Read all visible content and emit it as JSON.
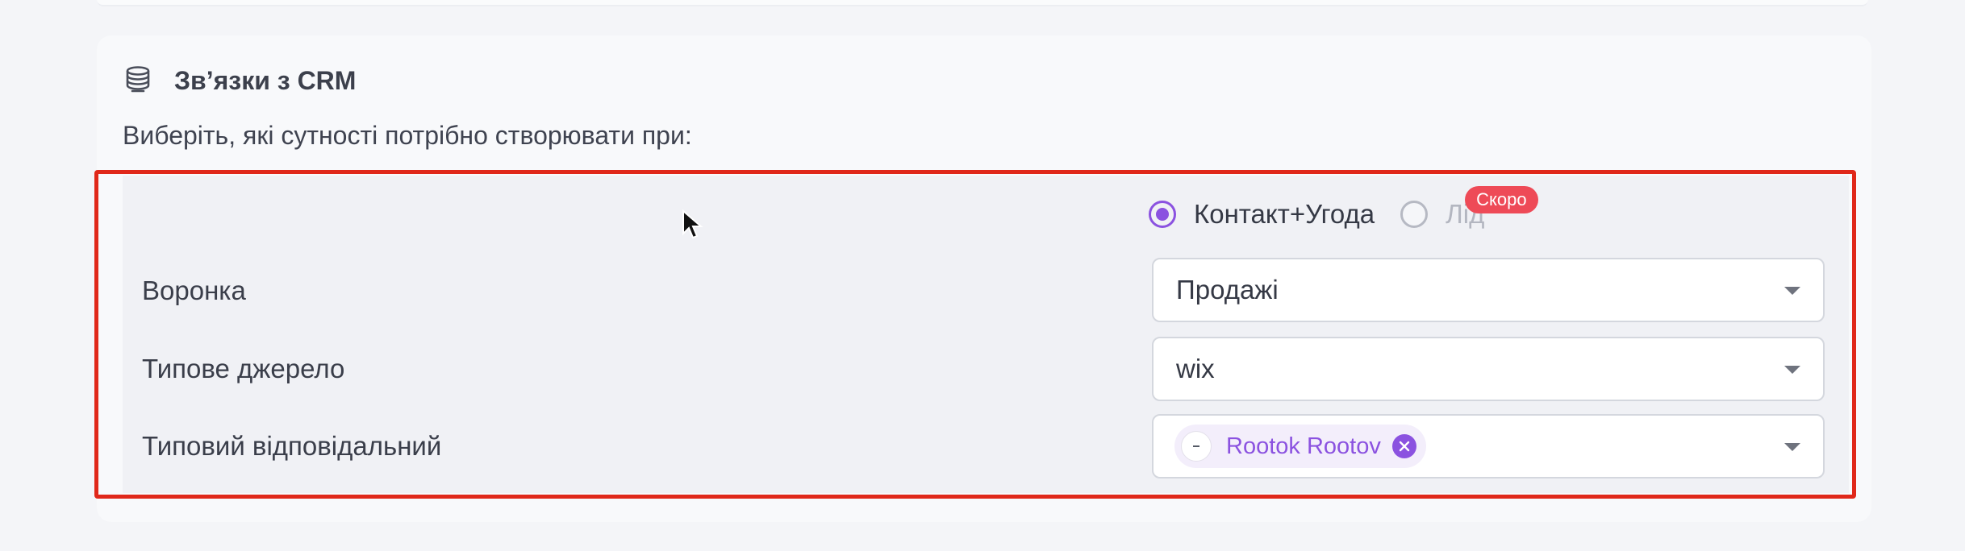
{
  "card": {
    "title": "Зв’язки з CRM",
    "subtitle": "Виберіть, які сутності потрібно створювати при:",
    "icon": "database-stack-icon"
  },
  "entity_options": [
    {
      "label": "Контакт+Угода",
      "checked": true
    },
    {
      "label": "Лід",
      "checked": false,
      "badge": "Скоро"
    }
  ],
  "fields": {
    "funnel": {
      "label": "Воронка",
      "value": "Продажі"
    },
    "source": {
      "label": "Типове джерело",
      "value": "wix"
    },
    "responsible": {
      "label": "Типовий відповідальний",
      "chip": "Rootok Rootov"
    }
  },
  "colors": {
    "accent": "#8b52e0",
    "highlight": "#e0281a",
    "badge": "#ee4a57"
  }
}
